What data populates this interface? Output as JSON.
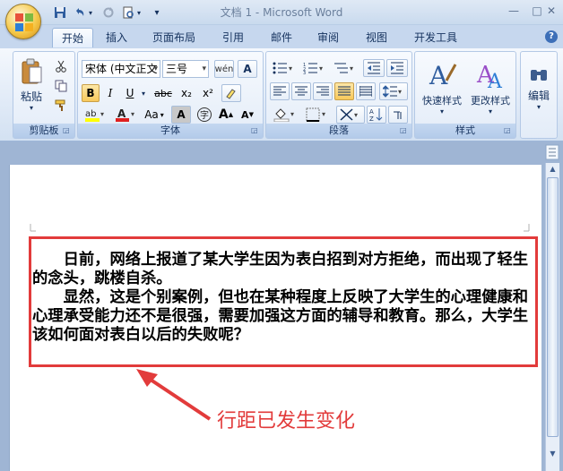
{
  "window": {
    "title": "文档 1 - Microsoft Word",
    "minimize": "—",
    "maximize": "□",
    "close": "✕"
  },
  "quick_access": {
    "save_icon": "save-icon",
    "undo_icon": "undo-icon",
    "redo_icon": "redo-icon",
    "print_preview_icon": "print-preview-icon",
    "customize_icon": "chevron-down-icon"
  },
  "tabs": [
    {
      "label": "开始",
      "active": true
    },
    {
      "label": "插入"
    },
    {
      "label": "页面布局"
    },
    {
      "label": "引用"
    },
    {
      "label": "邮件"
    },
    {
      "label": "审阅"
    },
    {
      "label": "视图"
    },
    {
      "label": "开发工具"
    }
  ],
  "ribbon": {
    "clipboard": {
      "label": "剪贴板",
      "paste": "粘贴"
    },
    "font": {
      "label": "字体",
      "font_name": "宋体 (中文正文",
      "font_size": "三号",
      "bold": "B",
      "italic": "I",
      "underline": "U",
      "strike": "abc",
      "subscript": "x₂",
      "superscript": "x²",
      "change_case": "Aa",
      "char_border": "A",
      "enclose": "字",
      "grow": "A",
      "shrink": "A"
    },
    "paragraph": {
      "label": "段落"
    },
    "styles": {
      "label": "样式",
      "quick_styles": "快速样式",
      "change_styles": "更改样式"
    },
    "editing": {
      "label": "编辑"
    }
  },
  "document": {
    "paragraphs": [
      "日前，网络上报道了某大学生因为表白招到对方拒绝，而出现了轻生的念头，跳楼自杀。",
      "显然，这是个别案例，但也在某种程度上反映了大学生的心理健康和心理承受能力还不是很强，需要加强这方面的辅导和教育。那么，大学生该如何面对表白以后的失败呢？"
    ]
  },
  "annotation": {
    "text": "行距已发生变化",
    "color": "#e23b3b"
  }
}
